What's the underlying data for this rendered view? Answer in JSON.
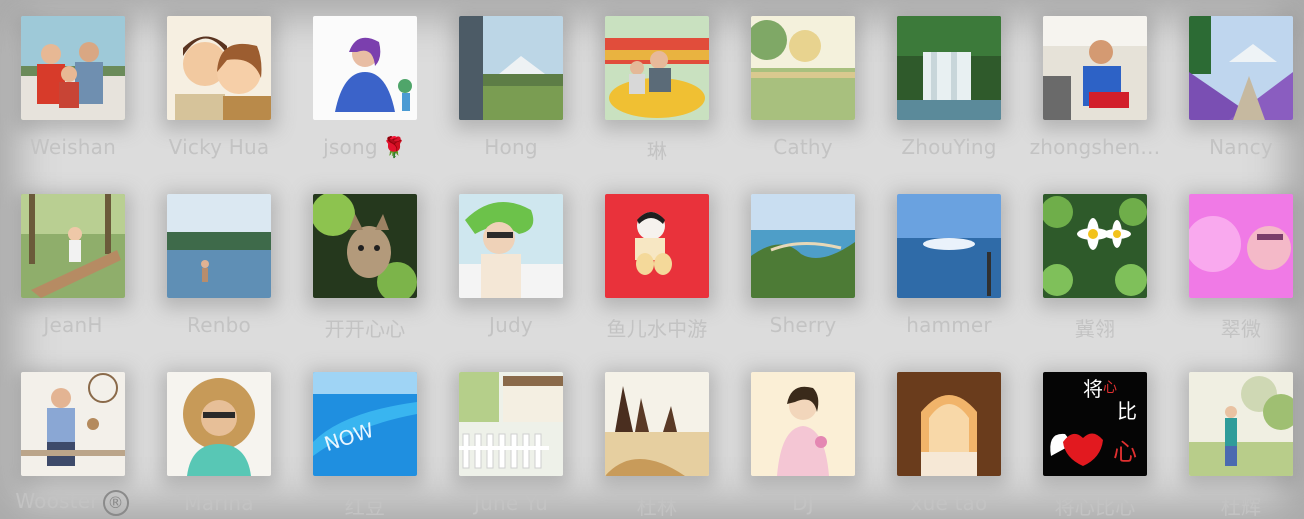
{
  "contacts": [
    {
      "name": "Weishan",
      "emoji": ""
    },
    {
      "name": "Vicky Hua",
      "emoji": ""
    },
    {
      "name": "jsong",
      "emoji": "🌹"
    },
    {
      "name": "Hong",
      "emoji": ""
    },
    {
      "name": "琳",
      "emoji": ""
    },
    {
      "name": "Cathy",
      "emoji": ""
    },
    {
      "name": "ZhouYing",
      "emoji": ""
    },
    {
      "name": "zhongshen…",
      "emoji": ""
    },
    {
      "name": "Nancy",
      "emoji": ""
    },
    {
      "name": "JeanH",
      "emoji": ""
    },
    {
      "name": "Renbo",
      "emoji": ""
    },
    {
      "name": "开开心心",
      "emoji": ""
    },
    {
      "name": "Judy",
      "emoji": ""
    },
    {
      "name": "鱼儿水中游",
      "emoji": ""
    },
    {
      "name": "Sherry",
      "emoji": ""
    },
    {
      "name": "hammer",
      "emoji": ""
    },
    {
      "name": "冀翎",
      "emoji": ""
    },
    {
      "name": "翠微",
      "emoji": ""
    },
    {
      "name": "Wooster",
      "emoji": "®"
    },
    {
      "name": "Marina",
      "emoji": ""
    },
    {
      "name": "红豆",
      "emoji": ""
    },
    {
      "name": "June Yu",
      "emoji": ""
    },
    {
      "name": "杜林",
      "emoji": ""
    },
    {
      "name": "DJ",
      "emoji": ""
    },
    {
      "name": "xue tao",
      "emoji": ""
    },
    {
      "name": "将心比心",
      "emoji": ""
    },
    {
      "name": "杜辉",
      "emoji": ""
    }
  ],
  "avatar_text": {
    "heart_top": "将",
    "heart_mid": "心",
    "heart_right": "比",
    "heart_bottom": "心"
  }
}
